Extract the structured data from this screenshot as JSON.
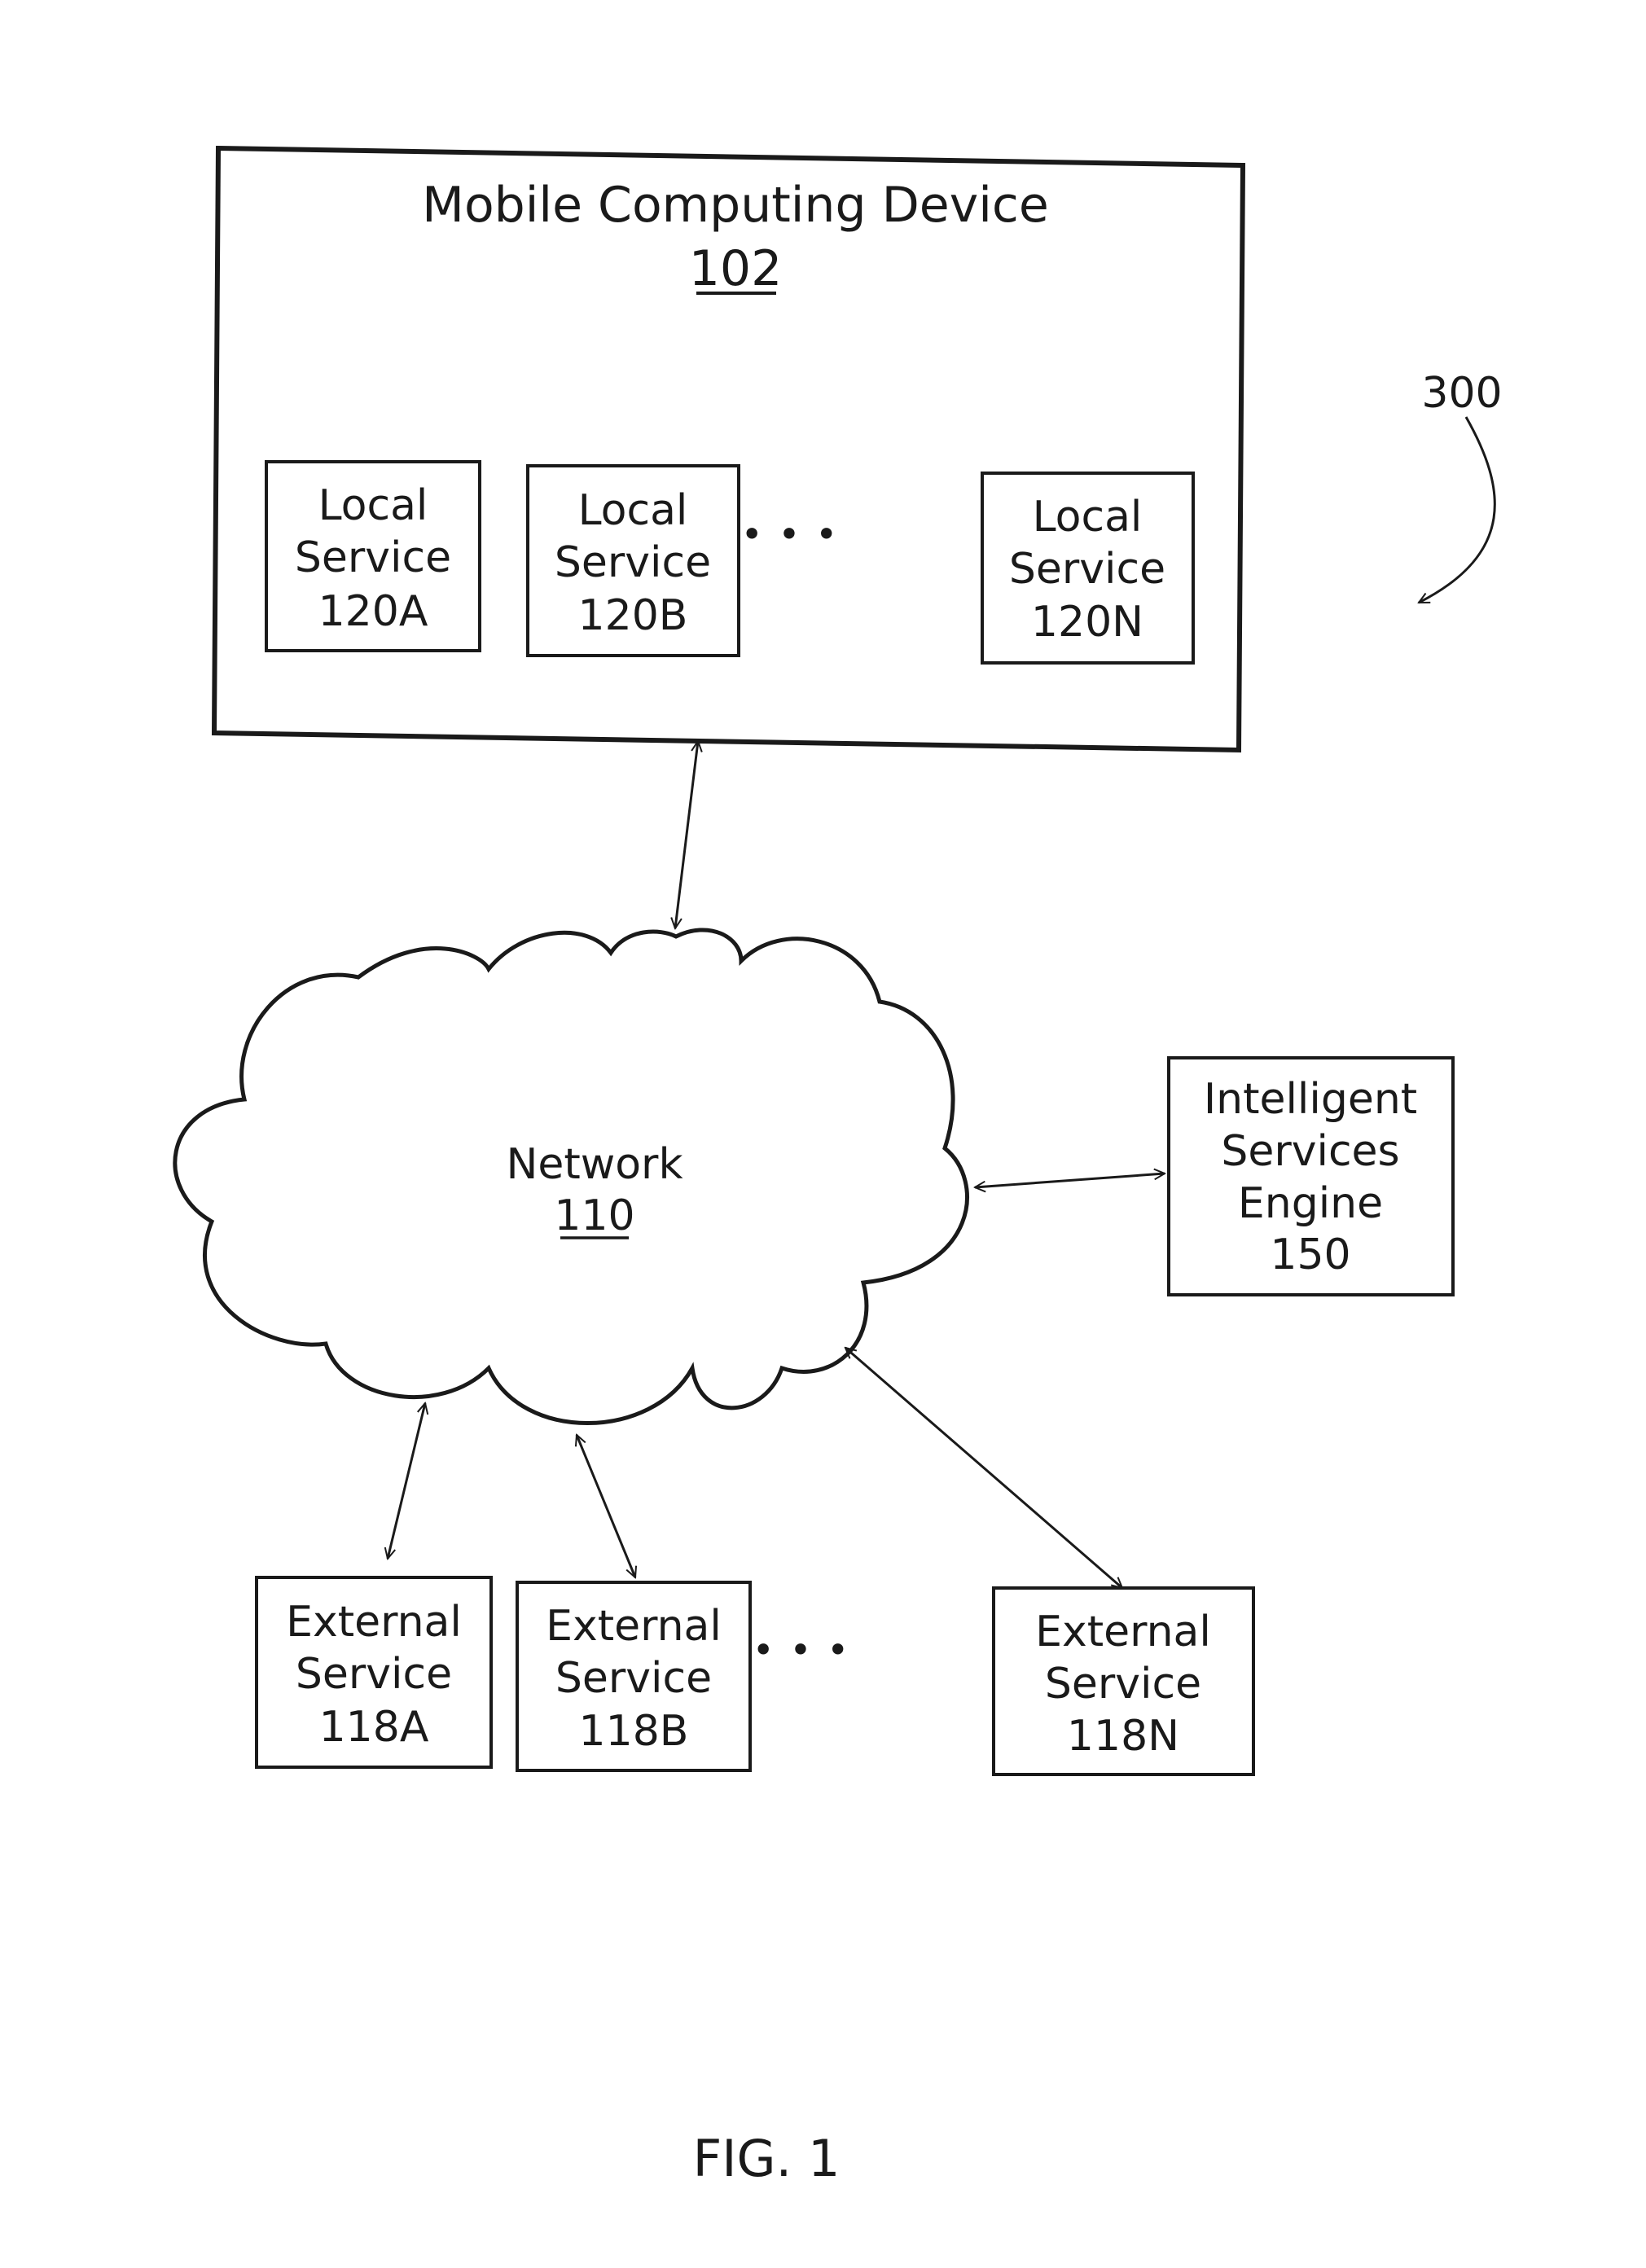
{
  "figure": {
    "caption": "FIG. 1",
    "reference_number": "300"
  },
  "mobile_device": {
    "title": "Mobile Computing Device",
    "number": "102",
    "local_services": [
      {
        "line1": "Local",
        "line2": "Service",
        "line3": "120A"
      },
      {
        "line1": "Local",
        "line2": "Service",
        "line3": "120B"
      },
      {
        "line1": "Local",
        "line2": "Service",
        "line3": "120N"
      }
    ],
    "ellipsis": "• • •"
  },
  "network": {
    "title": "Network",
    "number": "110"
  },
  "intelligent_services_engine": {
    "line1": "Intelligent",
    "line2": "Services",
    "line3": "Engine",
    "line4": "150"
  },
  "external_services": [
    {
      "line1": "External",
      "line2": "Service",
      "line3": "118A"
    },
    {
      "line1": "External",
      "line2": "Service",
      "line3": "118B"
    },
    {
      "line1": "External",
      "line2": "Service",
      "line3": "118N"
    }
  ],
  "external_ellipsis": "• • •"
}
